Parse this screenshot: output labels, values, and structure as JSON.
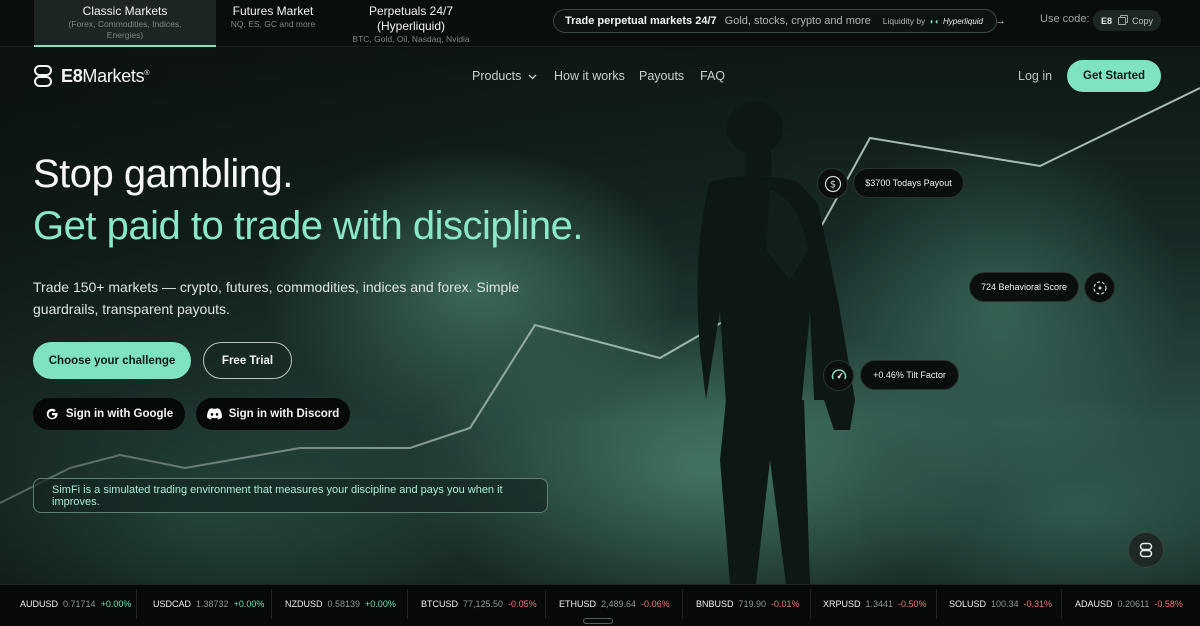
{
  "topbar": {
    "tabs": [
      {
        "title": "Classic Markets",
        "sub1": "(Forex, Commodities, Indices,",
        "sub2": "Energies)"
      },
      {
        "title": "Futures Market",
        "sub1": "NQ, ES, GC and more",
        "sub2": ""
      },
      {
        "title": "Perpetuals 24/7 (Hyperliquid)",
        "sub1": "BTC, Gold, Oil, Nasdaq, Nvidia",
        "sub2": ""
      }
    ],
    "promo": {
      "bold": "Trade perpetual markets 24/7",
      "text": "Gold, stocks, crypto and more",
      "liquidity": "Liquidity by",
      "partner": "Hyperliquid"
    },
    "use_code_label": "Use code:",
    "code": "E8",
    "copy_label": "Copy"
  },
  "nav": {
    "logo_bold": "E8",
    "logo_rest": "Markets",
    "logo_mark": "®",
    "links": [
      "Products",
      "How it works",
      "Payouts",
      "FAQ"
    ],
    "login": "Log in",
    "cta": "Get Started"
  },
  "hero": {
    "title": "Stop gambling.",
    "subtitle": "Get paid to trade with discipline.",
    "lead": "Trade 150+ markets — crypto, futures, commodities, indices and forex. Simple guardrails, transparent payouts.",
    "btn_challenge": "Choose your challenge",
    "btn_trial": "Free Trial",
    "btn_google": "Sign in with Google",
    "btn_discord": "Sign in with Discord",
    "simfi": "SimFi is a simulated trading environment that measures your discipline and pays you when it improves."
  },
  "stats": {
    "payout": "$3700 Todays Payout",
    "behavioral": "724 Behavioral Score",
    "tilt": "+0.46% Tilt Factor"
  },
  "ticker": [
    {
      "sym": "AUDUSD",
      "px": "0.71714",
      "chg": "+0.00%",
      "dir": "up"
    },
    {
      "sym": "USDCAD",
      "px": "1.38732",
      "chg": "+0.00%",
      "dir": "up"
    },
    {
      "sym": "NZDUSD",
      "px": "0.58139",
      "chg": "+0.00%",
      "dir": "up"
    },
    {
      "sym": "BTCUSD",
      "px": "77,125.50",
      "chg": "-0.05%",
      "dir": "dn"
    },
    {
      "sym": "ETHUSD",
      "px": "2,489.64",
      "chg": "-0.06%",
      "dir": "dn"
    },
    {
      "sym": "BNBUSD",
      "px": "719.90",
      "chg": "-0.01%",
      "dir": "dn"
    },
    {
      "sym": "XRPUSD",
      "px": "1.3441",
      "chg": "-0.50%",
      "dir": "dn"
    },
    {
      "sym": "SOLUSD",
      "px": "100.34",
      "chg": "-0.31%",
      "dir": "dn"
    },
    {
      "sym": "ADAUSD",
      "px": "0.20611",
      "chg": "-0.58%",
      "dir": "dn"
    }
  ],
  "colors": {
    "accent": "#7fe3c3",
    "up": "#6fe0b7",
    "down": "#f37373",
    "background": "#0b1110"
  }
}
